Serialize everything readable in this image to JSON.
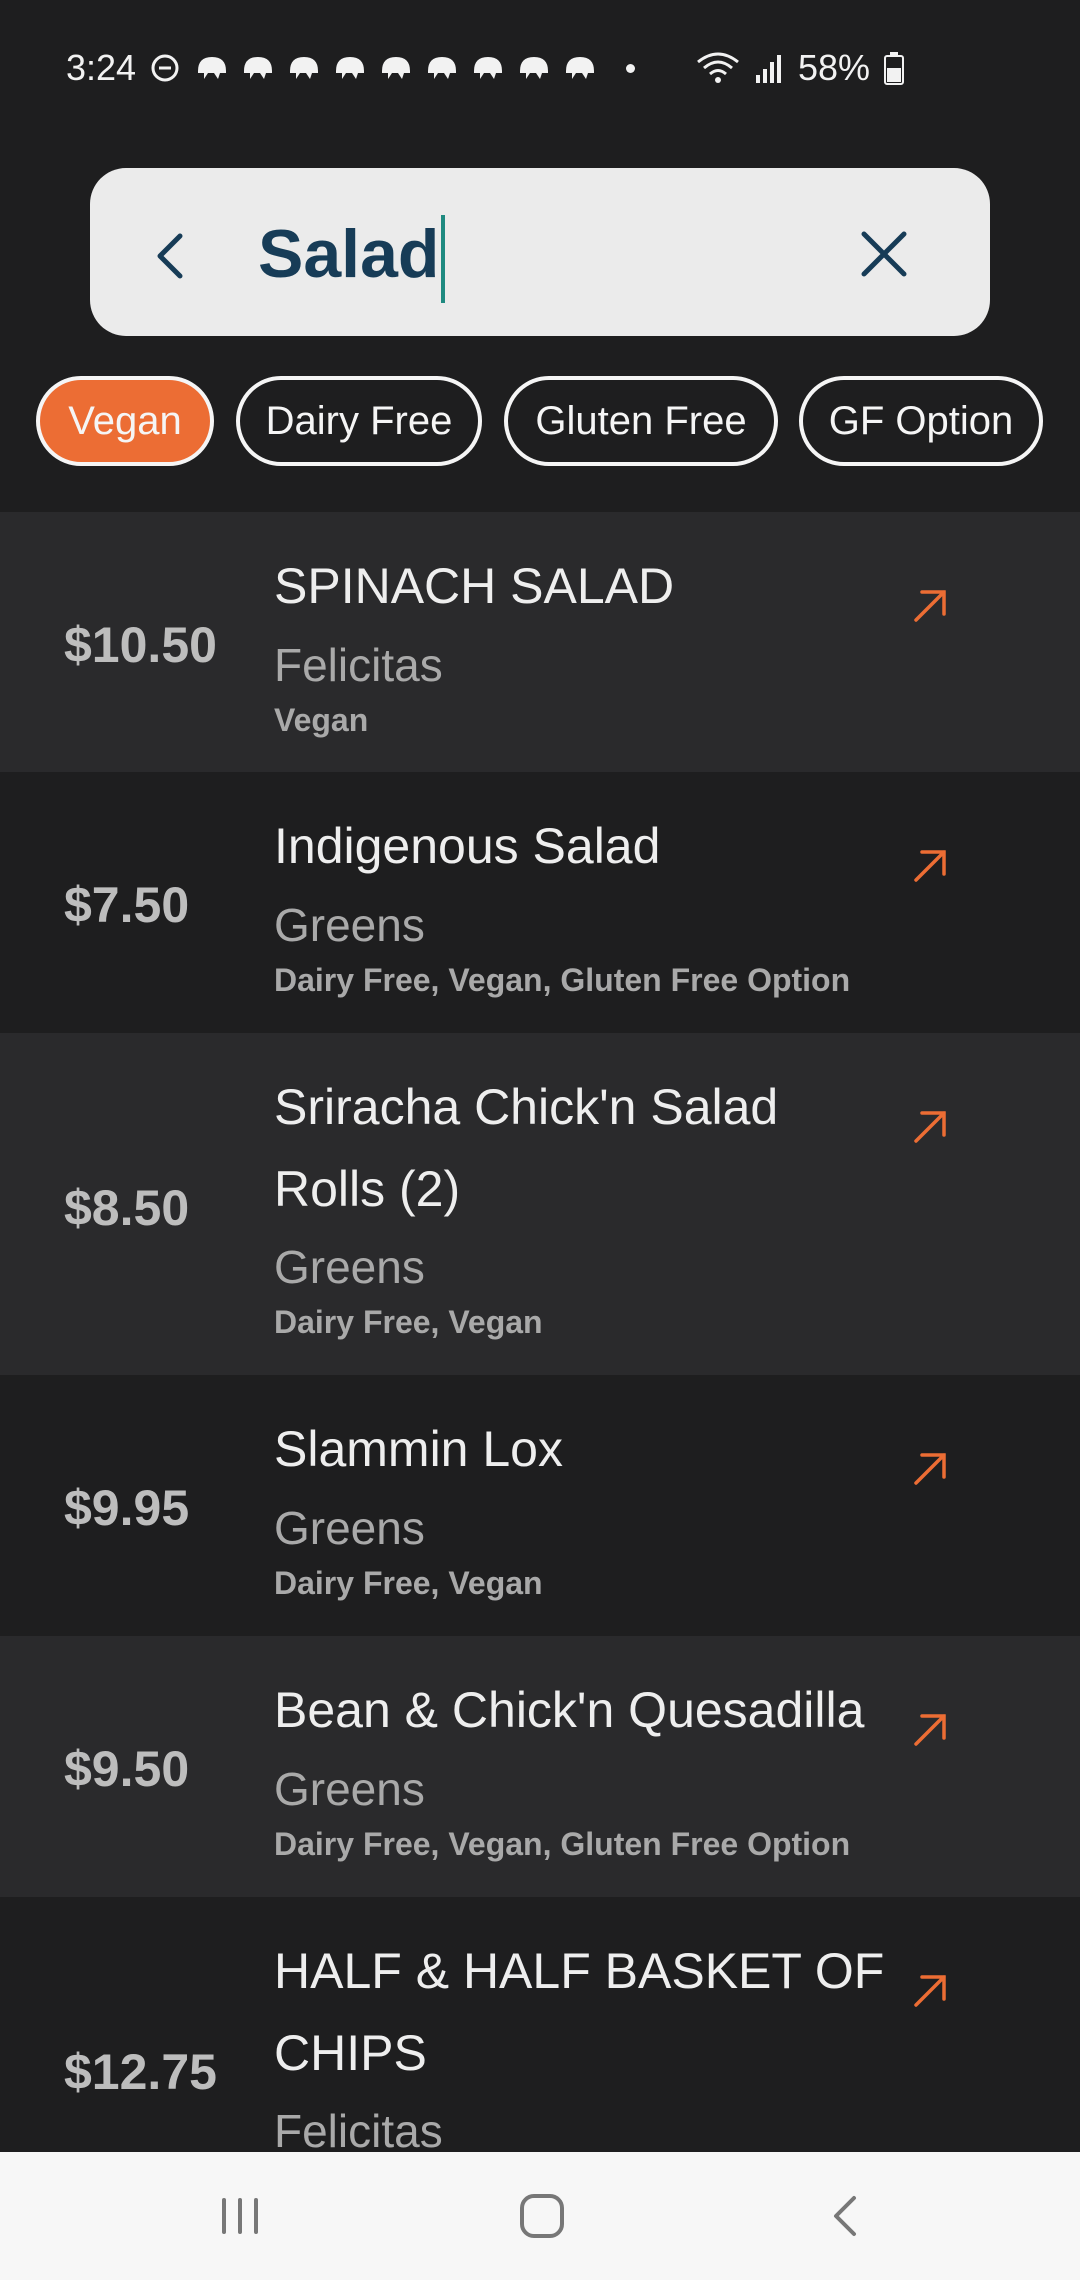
{
  "status_bar": {
    "time": "3:24",
    "battery": "58%",
    "icons": [
      "do-not-disturb-icon",
      "notification-icon",
      "wifi-icon",
      "signal-icon",
      "battery-icon"
    ]
  },
  "search": {
    "query": "Salad",
    "back_icon": "back-icon",
    "clear_icon": "close-icon"
  },
  "filters": [
    {
      "label": "Vegan",
      "active": true
    },
    {
      "label": "Dairy Free",
      "active": false
    },
    {
      "label": "Gluten Free",
      "active": false
    },
    {
      "label": "GF Option",
      "active": false
    }
  ],
  "results": [
    {
      "price": "$10.50",
      "name": "SPINACH SALAD",
      "vendor": "Felicitas",
      "tags": "Vegan"
    },
    {
      "price": "$7.50",
      "name": "Indigenous Salad",
      "vendor": "Greens",
      "tags": "Dairy Free, Vegan, Gluten Free Option"
    },
    {
      "price": "$8.50",
      "name": "Sriracha Chick'n Salad Rolls (2)",
      "vendor": "Greens",
      "tags": "Dairy Free, Vegan"
    },
    {
      "price": "$9.95",
      "name": "Slammin Lox",
      "vendor": "Greens",
      "tags": "Dairy Free, Vegan"
    },
    {
      "price": "$9.50",
      "name": "Bean & Chick'n Quesadilla",
      "vendor": "Greens",
      "tags": "Dairy Free, Vegan, Gluten Free Option"
    },
    {
      "price": "$12.75",
      "name": "HALF & HALF BASKET OF CHIPS",
      "vendor": "Felicitas",
      "tags": ""
    }
  ],
  "colors": {
    "accent": "#ec6d34",
    "background": "#1e1e1f",
    "row_alt": "#2a2a2c",
    "search_text": "#173c57"
  },
  "nav": [
    "recent-apps-icon",
    "home-icon",
    "back-icon"
  ]
}
